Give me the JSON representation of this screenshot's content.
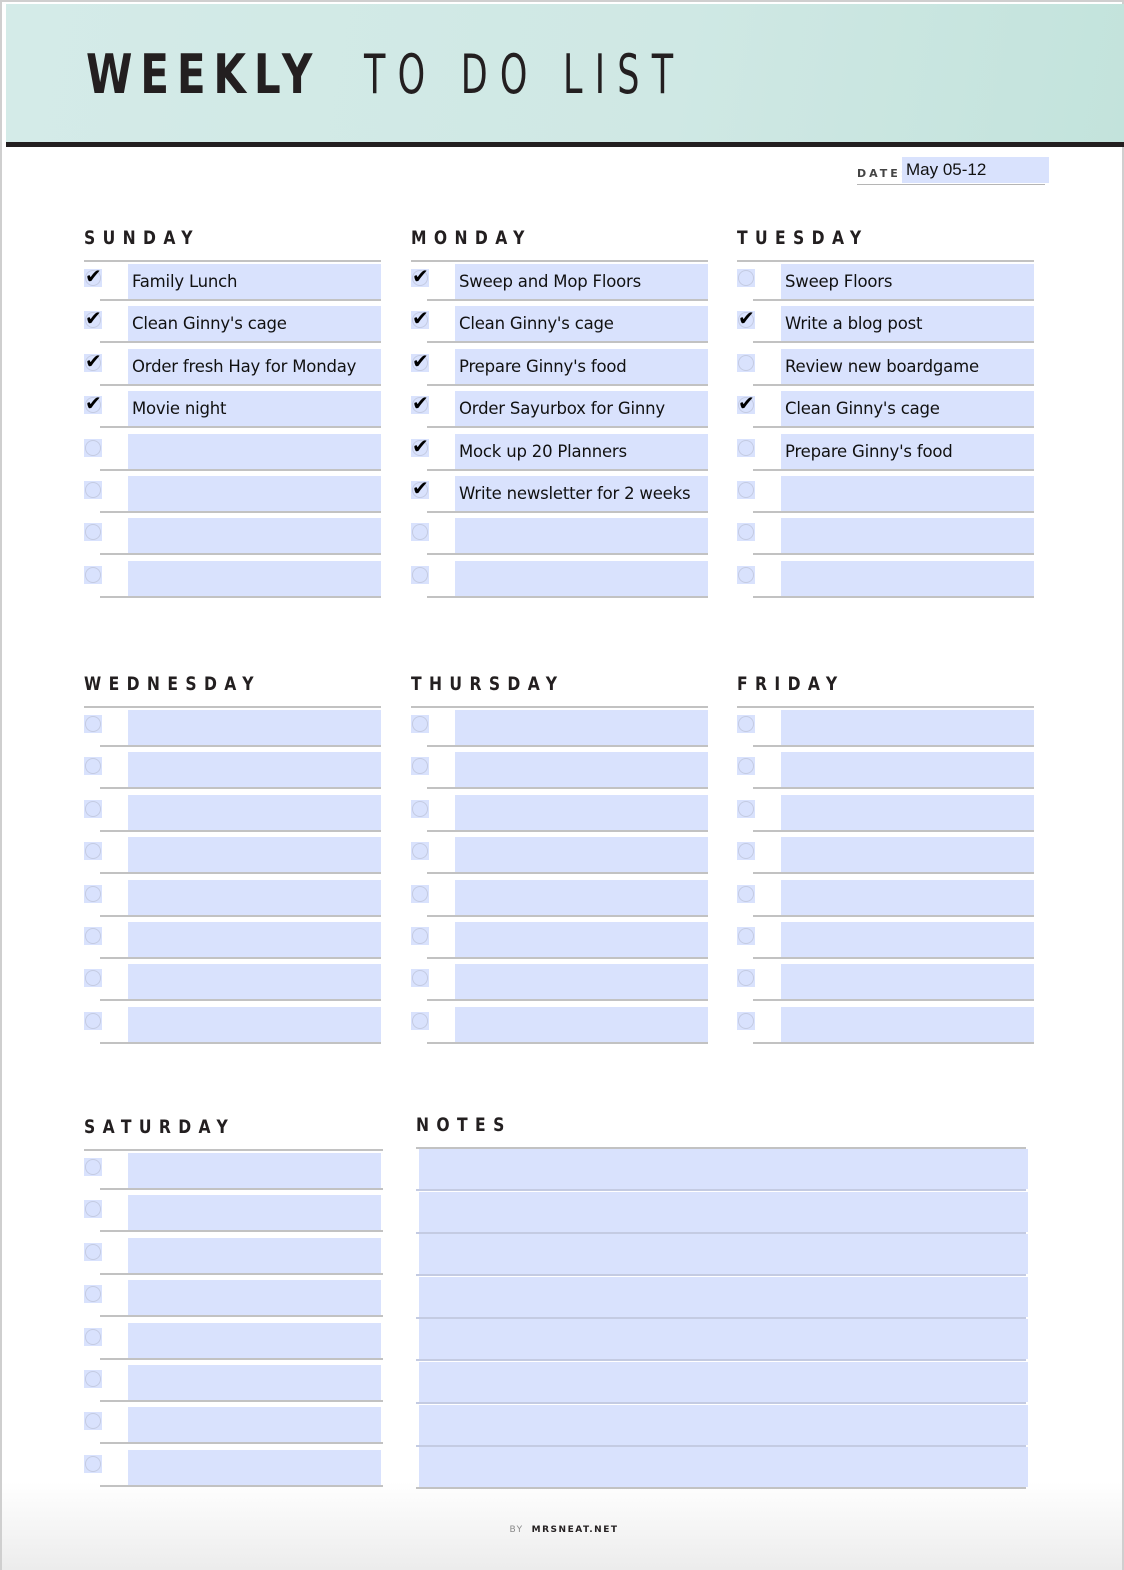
{
  "header": {
    "title_bold": "WEEKLY",
    "title_light": "TO DO LIST"
  },
  "date": {
    "label": "DATE:",
    "value": "May 05-12"
  },
  "days": [
    {
      "name": "SUNDAY",
      "items": [
        {
          "text": "Family Lunch",
          "checked": true
        },
        {
          "text": "Clean Ginny's cage",
          "checked": true
        },
        {
          "text": "Order fresh Hay for Monday",
          "checked": true
        },
        {
          "text": "Movie night",
          "checked": true
        },
        {
          "text": "",
          "checked": false
        },
        {
          "text": "",
          "checked": false
        },
        {
          "text": "",
          "checked": false
        },
        {
          "text": "",
          "checked": false
        }
      ]
    },
    {
      "name": "MONDAY",
      "items": [
        {
          "text": "Sweep and Mop Floors",
          "checked": true
        },
        {
          "text": "Clean Ginny's cage",
          "checked": true
        },
        {
          "text": "Prepare Ginny's food",
          "checked": true
        },
        {
          "text": "Order Sayurbox for Ginny",
          "checked": true
        },
        {
          "text": "Mock up 20 Planners",
          "checked": true
        },
        {
          "text": "Write newsletter for 2 weeks",
          "checked": true
        },
        {
          "text": "",
          "checked": false
        },
        {
          "text": "",
          "checked": false
        }
      ]
    },
    {
      "name": "TUESDAY",
      "items": [
        {
          "text": "Sweep Floors",
          "checked": false
        },
        {
          "text": "Write a blog post",
          "checked": true
        },
        {
          "text": "Review new boardgame",
          "checked": false
        },
        {
          "text": "Clean Ginny's cage",
          "checked": true
        },
        {
          "text": "Prepare Ginny's food",
          "checked": false
        },
        {
          "text": "",
          "checked": false
        },
        {
          "text": "",
          "checked": false
        },
        {
          "text": "",
          "checked": false
        }
      ]
    },
    {
      "name": "WEDNESDAY",
      "items": [
        {
          "text": "",
          "checked": false
        },
        {
          "text": "",
          "checked": false
        },
        {
          "text": "",
          "checked": false
        },
        {
          "text": "",
          "checked": false
        },
        {
          "text": "",
          "checked": false
        },
        {
          "text": "",
          "checked": false
        },
        {
          "text": "",
          "checked": false
        },
        {
          "text": "",
          "checked": false
        }
      ]
    },
    {
      "name": "THURSDAY",
      "items": [
        {
          "text": "",
          "checked": false
        },
        {
          "text": "",
          "checked": false
        },
        {
          "text": "",
          "checked": false
        },
        {
          "text": "",
          "checked": false
        },
        {
          "text": "",
          "checked": false
        },
        {
          "text": "",
          "checked": false
        },
        {
          "text": "",
          "checked": false
        },
        {
          "text": "",
          "checked": false
        }
      ]
    },
    {
      "name": "FRIDAY",
      "items": [
        {
          "text": "",
          "checked": false
        },
        {
          "text": "",
          "checked": false
        },
        {
          "text": "",
          "checked": false
        },
        {
          "text": "",
          "checked": false
        },
        {
          "text": "",
          "checked": false
        },
        {
          "text": "",
          "checked": false
        },
        {
          "text": "",
          "checked": false
        },
        {
          "text": "",
          "checked": false
        }
      ]
    },
    {
      "name": "SATURDAY",
      "items": [
        {
          "text": "",
          "checked": false
        },
        {
          "text": "",
          "checked": false
        },
        {
          "text": "",
          "checked": false
        },
        {
          "text": "",
          "checked": false
        },
        {
          "text": "",
          "checked": false
        },
        {
          "text": "",
          "checked": false
        },
        {
          "text": "",
          "checked": false
        },
        {
          "text": "",
          "checked": false
        }
      ]
    }
  ],
  "notes": {
    "title": "NOTES",
    "lines": [
      "",
      "",
      "",
      "",
      "",
      "",
      "",
      ""
    ]
  },
  "footer": {
    "by": "BY",
    "site": "MRSNEAT.NET"
  },
  "icons": {
    "checkmark": "✔"
  },
  "colors": {
    "header_bg": "#cfe8e4",
    "field_bg": "#d9e2fd",
    "text_dark": "#231f20"
  }
}
